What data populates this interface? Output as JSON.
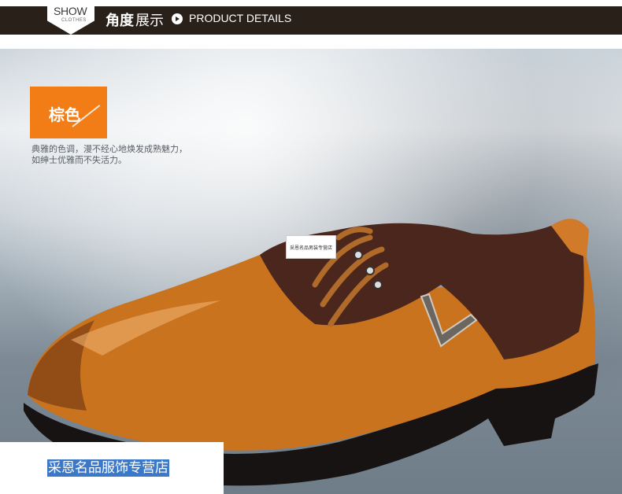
{
  "header": {
    "show_word": "SHOW",
    "show_sub": "CLOTHES",
    "title_bold": "角度",
    "title_normal": "展示",
    "title_en": "PRODUCT DETAILS",
    "bar_color": "#2a201a"
  },
  "product": {
    "color_badge": "棕色",
    "badge_color": "#f27d16",
    "description_line1": "典雅的色调，漫不经心地焕发成熟魅力，",
    "description_line2": "如绅士优雅而不失活力。",
    "watermark": "采恩名品男装专营店",
    "store_name": "采恩名品服饰专营店",
    "store_highlight_color": "#3c78c8",
    "image_icon": "leather-shoe-icon"
  }
}
